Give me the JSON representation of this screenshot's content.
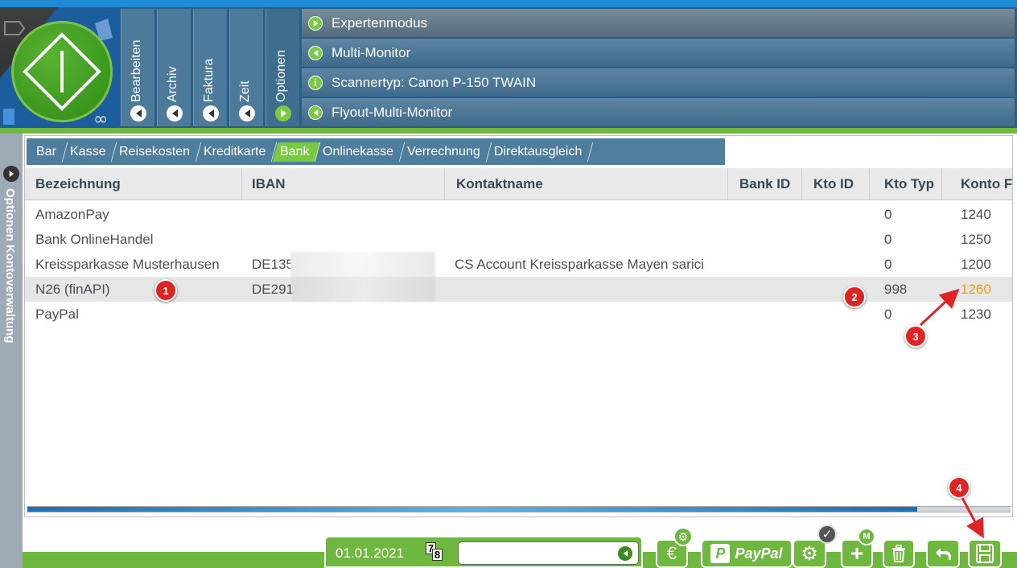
{
  "menu": {
    "bearbeiten": "Bearbeiten",
    "archiv": "Archiv",
    "faktura": "Faktura",
    "zeit": "Zeit",
    "optionen": "Optionen"
  },
  "settings": [
    {
      "label": "Expertenmodus",
      "icon": "arrow-right-icon"
    },
    {
      "label": "Multi-Monitor",
      "icon": "arrow-left-icon"
    },
    {
      "label": "Scannertyp: Canon P-150 TWAIN",
      "icon": "info-icon"
    },
    {
      "label": "Flyout-Multi-Monitor",
      "icon": "arrow-left-icon"
    }
  ],
  "sidebar": {
    "label": "Optionen  Kontoverwaltung"
  },
  "tabs": [
    "Bar",
    "Kasse",
    "Reisekosten",
    "Kreditkarte",
    "Bank",
    "Onlinekasse",
    "Verrechnung",
    "Direktausgleich"
  ],
  "active_tab": "Bank",
  "columns": [
    "Bezeichnung",
    "IBAN",
    "Kontaktname",
    "Bank ID",
    "Kto ID",
    "Kto Typ",
    "Konto F"
  ],
  "rows": [
    {
      "bezeichnung": "AmazonPay",
      "iban": "",
      "kontakt": "",
      "kto_typ": "0",
      "konto": "1240"
    },
    {
      "bezeichnung": "Bank OnlineHandel",
      "iban": "",
      "kontakt": "",
      "kto_typ": "0",
      "konto": "1250"
    },
    {
      "bezeichnung": "Kreissparkasse Musterhausen",
      "iban": "DE135",
      "kontakt": "CS Account Kreissparkasse Mayen sarici",
      "kto_typ": "0",
      "konto": "1200"
    },
    {
      "bezeichnung": "N26 (finAPI)",
      "iban": "DE291",
      "kontakt": "",
      "kto_typ": "998",
      "konto": "1260"
    },
    {
      "bezeichnung": "PayPal",
      "iban": "",
      "kontakt": "",
      "kto_typ": "0",
      "konto": "1230"
    }
  ],
  "footer": {
    "date": "01.01.2021",
    "cal_a": "7",
    "cal_b": "8",
    "paypal": "PayPal",
    "euro": "€",
    "m_badge": "M"
  },
  "annotations": [
    "1",
    "2",
    "3",
    "4"
  ],
  "colors": {
    "accent_green": "#6fb83f",
    "header_blue": "#2c5d82",
    "highlight_orange": "#f39c12",
    "annotation_red": "#e02424"
  }
}
